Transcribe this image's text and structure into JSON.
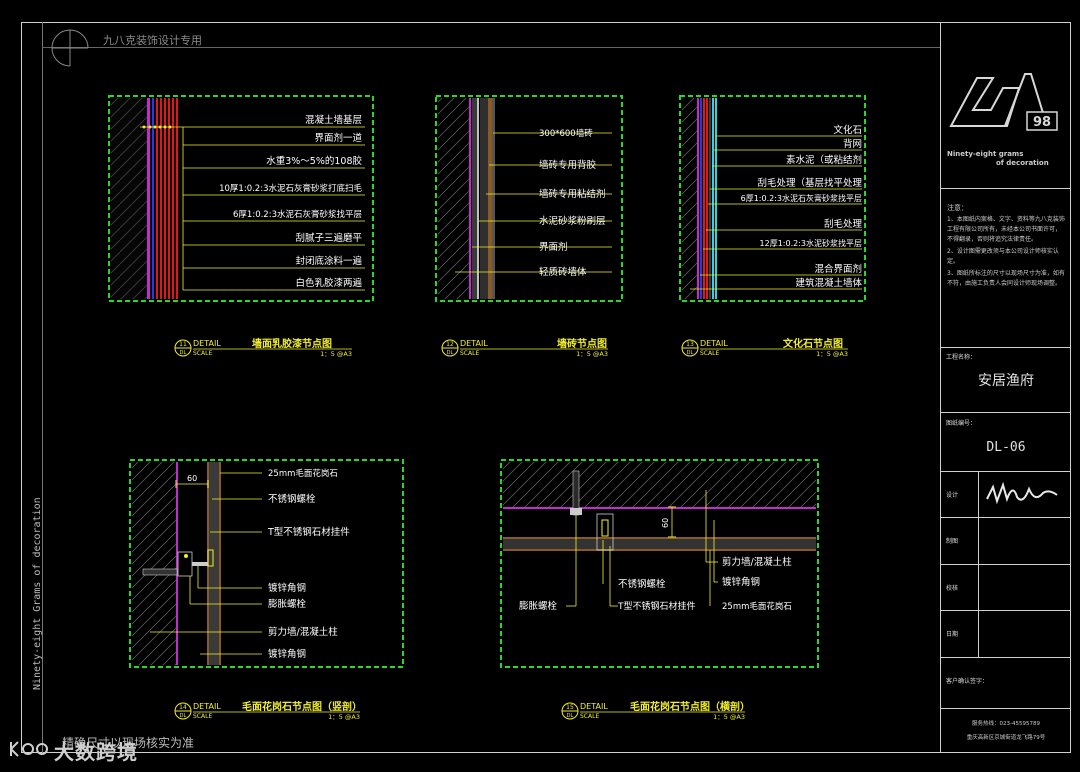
{
  "header": {
    "company": "九八克装饰设计专用"
  },
  "side_text": "Ninety-eight Grams of decoration",
  "footer": {
    "note": "精确尺寸以现场核实为准",
    "watermark": "大数跨境"
  },
  "title_block": {
    "logo_text": "98",
    "slogan_line1": "Ninety-eight grams",
    "slogan_line2": "of decoration",
    "notes_title": "注意：",
    "notes": [
      "1、本图纸内案格、文字、资料等九八克装饰工程有限公司所有，未经本公司书面许可，不得翻录，否则将追究法律责任。",
      "2、设计图需更改须与本公司设计师核实认定。",
      "3、图纸所标注的尺寸以现场尺寸为准，如有不符，由施工负责人会同设计师现场调整。"
    ],
    "project_label": "工程名称：",
    "project_name": "安居渔府",
    "drawing_no_label": "图纸编号：",
    "drawing_no": "DL-06",
    "designer_label": "设计",
    "drafter_label": "制图",
    "checker_label": "校核",
    "date_label": "日期",
    "client_label": "客户确认签字：",
    "phone": "服务热线：023-45595789",
    "address": "重庆高新区京城街道龙飞路79号"
  },
  "details": [
    {
      "id": "d1",
      "number": "11",
      "sheet": "DL",
      "detail_label": "DETAIL",
      "scale_label": "SCALE",
      "title": "墙面乳胶漆节点图",
      "scale": "1：5 @A3",
      "callouts": [
        "混凝土墙基层",
        "界面剂一道",
        "水重3%～5%的108胶",
        "10厚1:0.2:3水泥石灰膏砂浆打底扫毛",
        "6厚1:0.2:3水泥石灰膏砂浆找平层",
        "刮腻子三遍磨平",
        "封闭底涂料一遍",
        "白色乳胶漆两遍"
      ]
    },
    {
      "id": "d2",
      "number": "12",
      "sheet": "DL",
      "detail_label": "DETAIL",
      "scale_label": "SCALE",
      "title": "墙砖节点图",
      "scale": "1：5 @A3",
      "callouts": [
        "300*600墙砖",
        "墙砖专用背胶",
        "墙砖专用粘结剂",
        "水泥砂浆粉刷层",
        "界面剂",
        "轻质砖墙体"
      ]
    },
    {
      "id": "d3",
      "number": "13",
      "sheet": "DL",
      "detail_label": "DETAIL",
      "scale_label": "SCALE",
      "title": "文化石节点图",
      "scale": "1：5 @A3",
      "callouts": [
        "文化石",
        "背网",
        "素水泥（或粘结剂",
        "刮毛处理（基层找平处理",
        "6厚1:0.2:3水泥石灰膏砂浆找平层",
        "刮毛处理",
        "12厚1:0.2:3水泥砂浆找平层",
        "混合界面剂",
        "建筑混凝土墙体"
      ]
    },
    {
      "id": "d4",
      "number": "14",
      "sheet": "DL",
      "detail_label": "DETAIL",
      "scale_label": "SCALE",
      "title": "毛面花岗石节点图（竖剖）",
      "scale": "1：5 @A3",
      "dimension": "60",
      "callouts": [
        "25mm毛面花岗石",
        "不锈钢螺栓",
        "T型不锈钢石材挂件",
        "镀锌角钢",
        "膨胀螺栓",
        "剪力墙/混凝土柱",
        "镀锌角钢"
      ]
    },
    {
      "id": "d5",
      "number": "15",
      "sheet": "DL",
      "detail_label": "DETAIL",
      "scale_label": "SCALE",
      "title": "毛面花岗石节点图（横剖）",
      "scale": "1：5 @A3",
      "dimension": "60",
      "callouts": [
        "剪力墙/混凝土柱",
        "镀锌角钢",
        "不锈钢螺栓",
        "膨胀螺栓",
        "T型不锈钢石材挂件",
        "25mm毛面花岗石"
      ]
    }
  ],
  "colors": {
    "frame_green": "#28d828",
    "callout_yellow": "#f2ef2c",
    "magenta": "#c22bd0",
    "red": "#e01818",
    "cyan": "#2ad7e0",
    "brown": "#8a5a22"
  }
}
